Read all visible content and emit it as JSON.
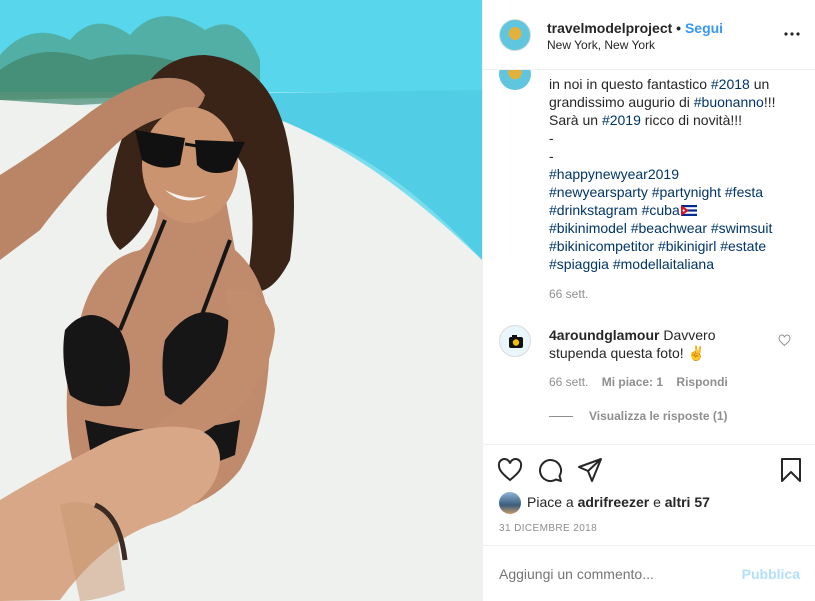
{
  "header": {
    "username": "travelmodelproject",
    "separator": "•",
    "follow_label": "Segui",
    "location": "New York, New York"
  },
  "caption": {
    "line1": "in noi in questo fantastico ",
    "tag_2018": "#2018",
    "line1_tail": " un",
    "line2_head": "grandissimo augurio di ",
    "tag_buonanno": "#buonanno",
    "line2_tail": "!!!",
    "line3_head": "Sarà un ",
    "tag_2019": "#2019",
    "line3_tail": " ricco di novità!!!",
    "dash1": "-",
    "dash2": "-",
    "tags": [
      "#happynewyear2019",
      "#newyearsparty",
      "#partynight",
      "#festa",
      "#drinkstagram",
      "#cuba",
      "#bikinimodel",
      "#beachwear",
      "#swimsuit",
      "#bikinicompetitor",
      "#bikinigirl",
      "#estate",
      "#spiaggia",
      "#modellaitaliana"
    ],
    "time": "66 sett."
  },
  "comment": {
    "username": "4aroundglamour",
    "text": "Davvero stupenda questa foto! ✌️",
    "text_line1": " Davvero",
    "text_line2": "stupenda questa foto! ✌️",
    "time": "66 sett.",
    "likes": "Mi piace: 1",
    "reply": "Rispondi",
    "view_replies": "Visualizza le risposte (1)"
  },
  "actions": {
    "icons": [
      "heart-icon",
      "comment-icon",
      "share-icon",
      "bookmark-icon"
    ]
  },
  "likes": {
    "prefix": "Piace a ",
    "user": "adrifreezer",
    "middle": " e ",
    "others": "altri 57"
  },
  "date": "31 DICEMBRE 2018",
  "add_comment": {
    "placeholder": "Aggiungi un commento...",
    "publish_label": "Pubblica"
  },
  "colors": {
    "link_blue": "#3897f0",
    "hashtag": "#003569",
    "muted": "#8e8e8e",
    "publish_disabled": "#b2dffc"
  }
}
